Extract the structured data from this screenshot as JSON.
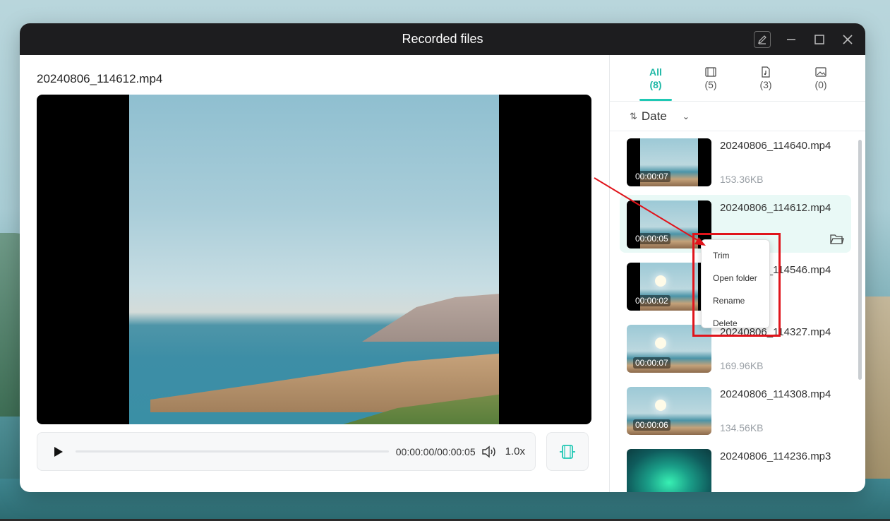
{
  "window": {
    "title": "Recorded files"
  },
  "player": {
    "file_title": "20240806_114612.mp4",
    "time": "00:00:00/00:00:05",
    "speed": "1.0x"
  },
  "tabs": [
    {
      "label": "All",
      "count": "(8)",
      "icon": "all"
    },
    {
      "label": "",
      "count": "(5)",
      "icon": "video-icon"
    },
    {
      "label": "",
      "count": "(3)",
      "icon": "audio-file-icon"
    },
    {
      "label": "",
      "count": "(0)",
      "icon": "image-icon"
    }
  ],
  "sort": {
    "label": "Date"
  },
  "files": [
    {
      "name": "20240806_114640.mp4",
      "duration": "00:00:07",
      "size": "153.36KB"
    },
    {
      "name": "20240806_114612.mp4",
      "duration": "00:00:05",
      "size": ""
    },
    {
      "name": "20240806_114546.mp4",
      "duration": "00:00:02",
      "size": ""
    },
    {
      "name": "20240806_114327.mp4",
      "duration": "00:00:07",
      "size": "169.96KB"
    },
    {
      "name": "20240806_114308.mp4",
      "duration": "00:00:06",
      "size": "134.56KB"
    },
    {
      "name": "20240806_114236.mp3",
      "duration": "",
      "size": ""
    }
  ],
  "context_menu": [
    "Trim",
    "Open folder",
    "Rename",
    "Delete"
  ],
  "colors": {
    "accent": "#1fc8b4",
    "highlight": "#e0141b",
    "titlebar": "#1d1d1f"
  }
}
